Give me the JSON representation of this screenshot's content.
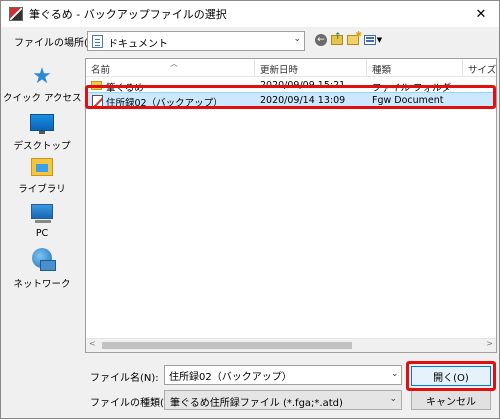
{
  "window": {
    "title": "筆ぐるめ - バックアップファイルの選択",
    "close_glyph": "✕"
  },
  "location": {
    "label": "ファイルの場所(I):",
    "value": "ドキュメント"
  },
  "places": [
    {
      "label": "クイック アクセス",
      "icon": "star-icon"
    },
    {
      "label": "デスクトップ",
      "icon": "desktop-icon"
    },
    {
      "label": "ライブラリ",
      "icon": "library-icon"
    },
    {
      "label": "PC",
      "icon": "pc-icon"
    },
    {
      "label": "ネットワーク",
      "icon": "network-icon"
    }
  ],
  "columns": {
    "name": "名前",
    "modified": "更新日時",
    "type": "種類",
    "size": "サイズ"
  },
  "rows": [
    {
      "name": "筆ぐるめ",
      "modified": "2020/09/09 15:21",
      "type": "ファイル フォルダー",
      "icon": "folder-icon"
    },
    {
      "name": "住所録02（バックアップ）",
      "modified": "2020/09/14 13:09",
      "type": "Fgw Document",
      "icon": "fgw-document-icon",
      "selected": true
    }
  ],
  "filename": {
    "label": "ファイル名(N):",
    "value": "住所録02（バックアップ）"
  },
  "filetype": {
    "label": "ファイルの種類(T):",
    "value": "筆ぐるめ住所録ファイル (*.fga;*.atd)"
  },
  "buttons": {
    "open": "開く(O)",
    "cancel": "キャンセル"
  },
  "colors": {
    "highlight": "#e01010",
    "selection": "#cce8ff"
  }
}
